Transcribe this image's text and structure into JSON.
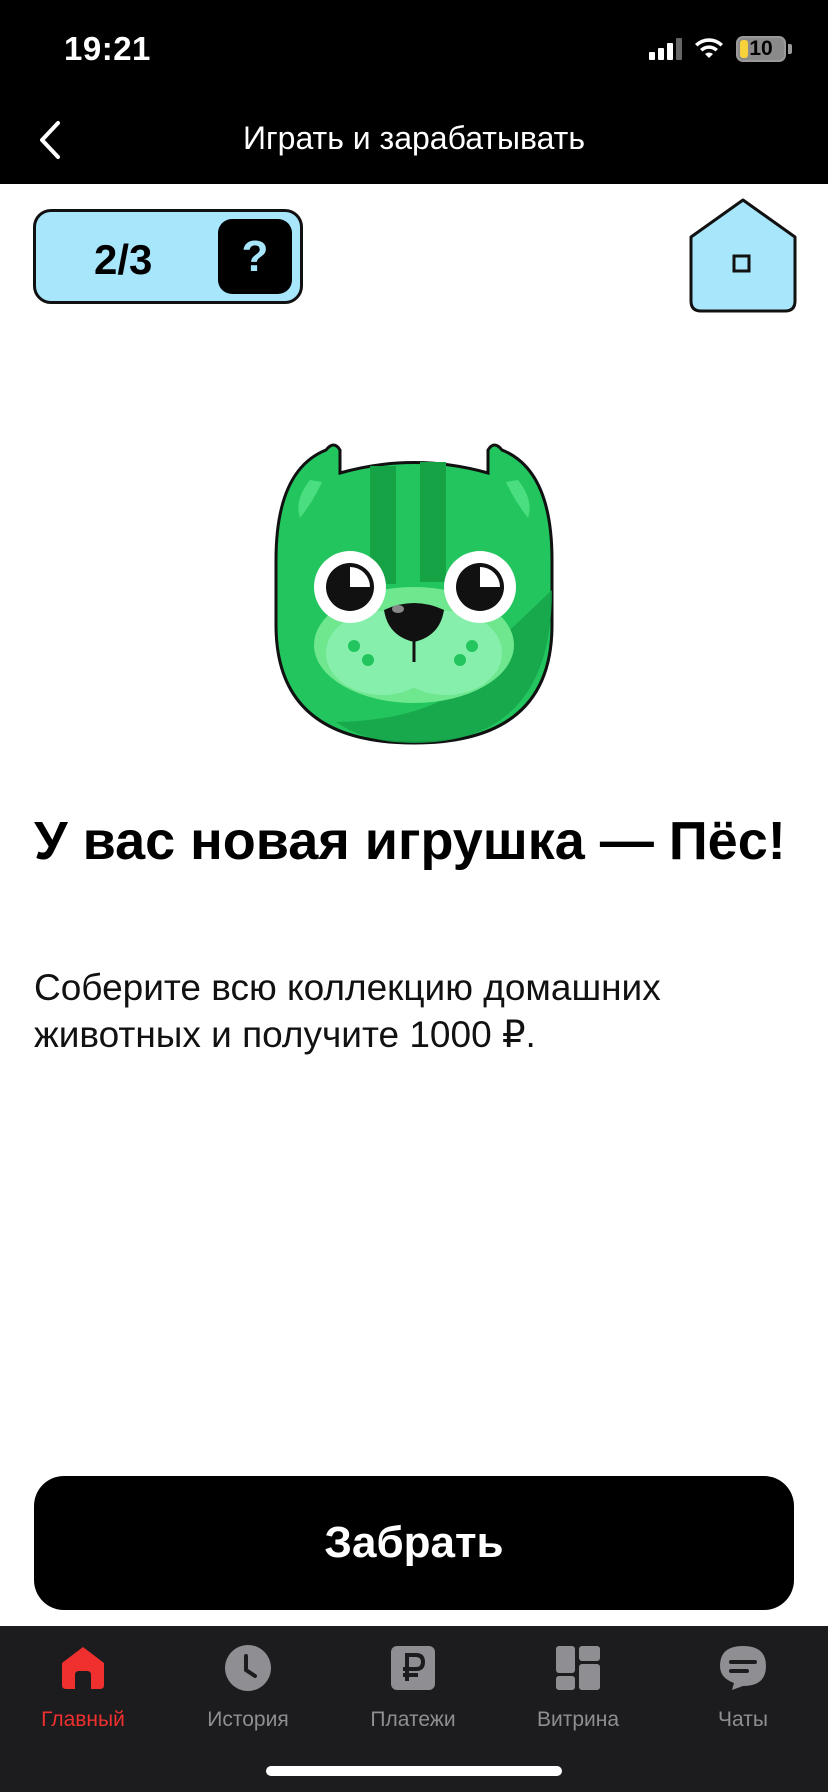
{
  "status": {
    "time": "19:21",
    "battery": "10"
  },
  "nav": {
    "title": "Играть и зарабатывать"
  },
  "counter": {
    "value": "2/3",
    "help": "?"
  },
  "reward": {
    "headline": "У вас новая игрушка — Пёс!",
    "description": "Соберите всю коллекцию домашних животных и получите 1000 ₽.",
    "claim_label": "Забрать"
  },
  "tabs": [
    {
      "label": "Главный",
      "icon": "home-icon",
      "active": true
    },
    {
      "label": "История",
      "icon": "clock-icon",
      "active": false
    },
    {
      "label": "Платежи",
      "icon": "ruble-icon",
      "active": false
    },
    {
      "label": "Витрина",
      "icon": "grid-icon",
      "active": false
    },
    {
      "label": "Чаты",
      "icon": "chat-icon",
      "active": false
    }
  ],
  "colors": {
    "accent_active": "#f0302f",
    "badge_bg": "#a8e6fb",
    "pet_green": "#22c55e"
  }
}
